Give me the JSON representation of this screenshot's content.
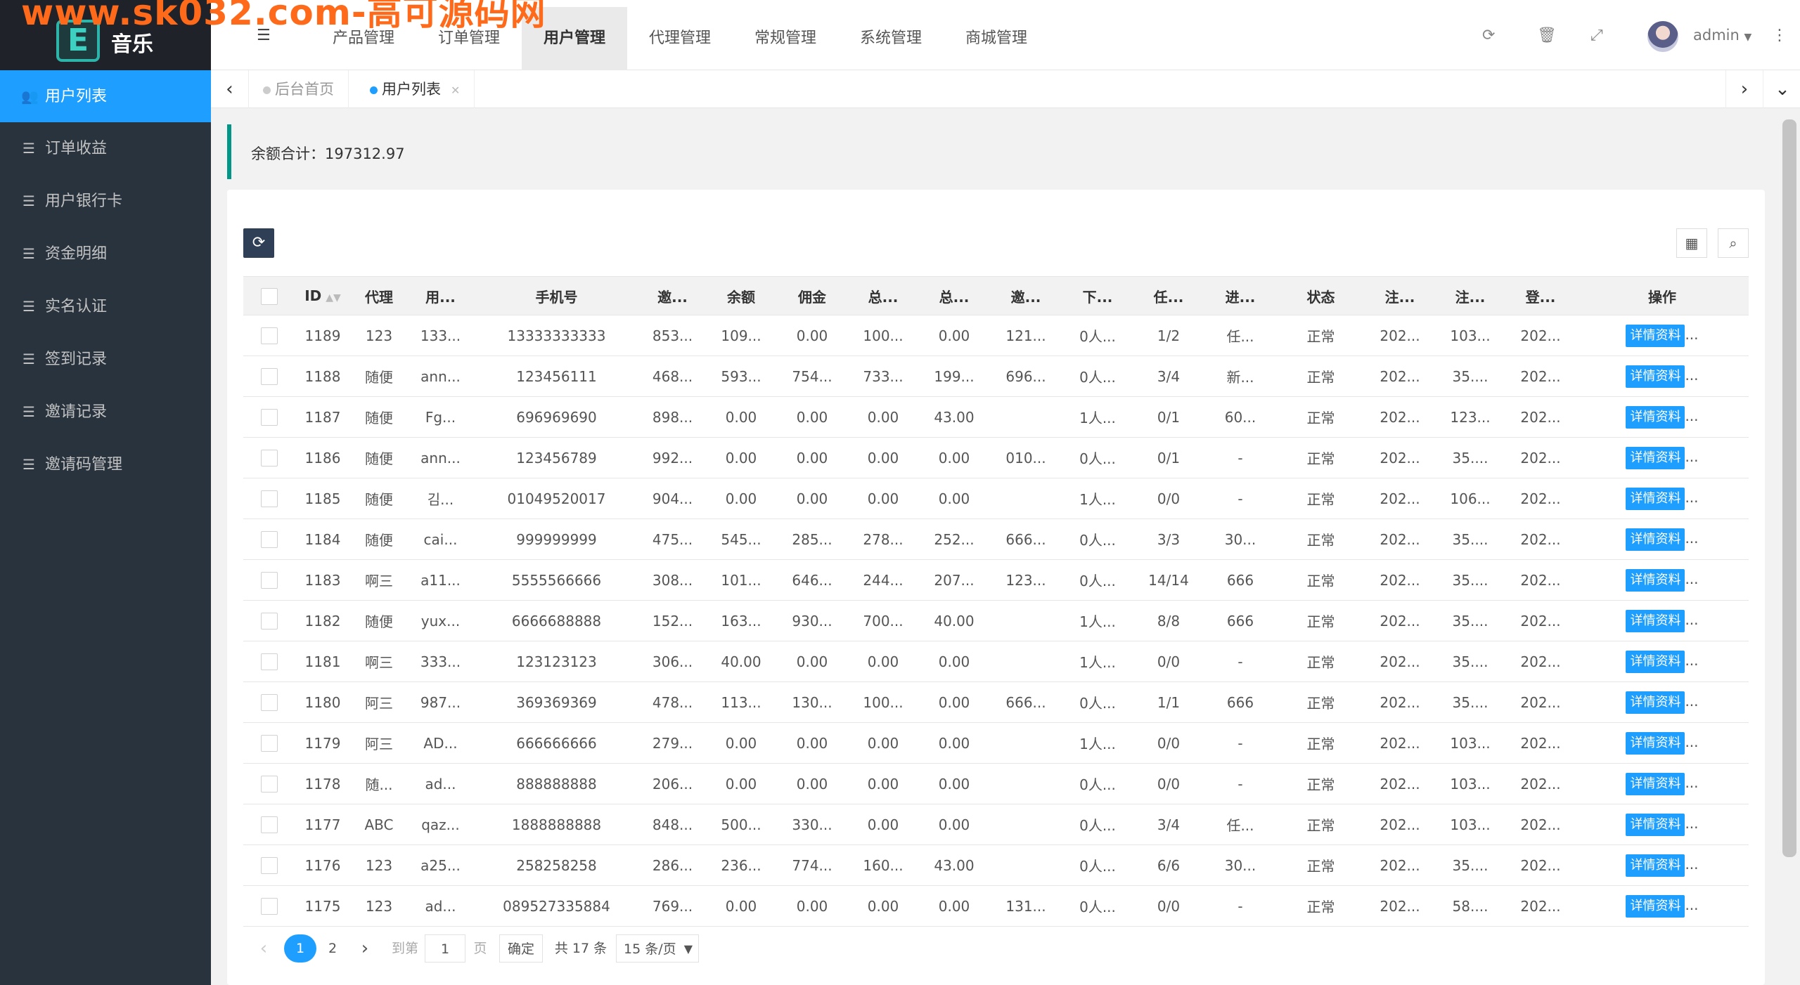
{
  "watermark": "www.sk032.com-高可源码网",
  "logo": {
    "letter": "E",
    "text": "音乐"
  },
  "sidebar": {
    "items": [
      {
        "label": "用户列表",
        "icon": "users-icon"
      },
      {
        "label": "订单收益",
        "icon": "list-icon"
      },
      {
        "label": "用户银行卡",
        "icon": "list-icon"
      },
      {
        "label": "资金明细",
        "icon": "list-icon"
      },
      {
        "label": "实名认证",
        "icon": "list-icon"
      },
      {
        "label": "签到记录",
        "icon": "list-icon"
      },
      {
        "label": "邀请记录",
        "icon": "list-icon"
      },
      {
        "label": "邀请码管理",
        "icon": "list-icon"
      }
    ]
  },
  "header": {
    "nav": [
      "产品管理",
      "订单管理",
      "用户管理",
      "代理管理",
      "常规管理",
      "系统管理",
      "商城管理"
    ],
    "active_nav": "用户管理",
    "user": "admin"
  },
  "tabs": [
    {
      "label": "后台首页"
    },
    {
      "label": "用户列表"
    }
  ],
  "notice": "余额合计：197312.97",
  "table": {
    "columns": [
      "",
      "ID",
      "代理",
      "用...",
      "手机号",
      "邀...",
      "余额",
      "佣金",
      "总...",
      "总...",
      "邀...",
      "下...",
      "任...",
      "进...",
      "状态",
      "注...",
      "注...",
      "登...",
      "操作"
    ],
    "rows": [
      [
        "1189",
        "123",
        "133...",
        "13333333333",
        "853...",
        "109...",
        "0.00",
        "100...",
        "0.00",
        "121...",
        "0人...",
        "1/2",
        "任...",
        "正常",
        "202...",
        "103...",
        "202..."
      ],
      [
        "1188",
        "随便",
        "ann...",
        "123456111",
        "468...",
        "593...",
        "754...",
        "733...",
        "199...",
        "696...",
        "0人...",
        "3/4",
        "新...",
        "正常",
        "202...",
        "35....",
        "202..."
      ],
      [
        "1187",
        "随便",
        "Fg...",
        "696969690",
        "898...",
        "0.00",
        "0.00",
        "0.00",
        "43.00",
        "",
        "1人...",
        "0/1",
        "60...",
        "正常",
        "202...",
        "123...",
        "202..."
      ],
      [
        "1186",
        "随便",
        "ann...",
        "123456789",
        "992...",
        "0.00",
        "0.00",
        "0.00",
        "0.00",
        "010...",
        "0人...",
        "0/1",
        "-",
        "正常",
        "202...",
        "35....",
        "202..."
      ],
      [
        "1185",
        "随便",
        "김...",
        "01049520017",
        "904...",
        "0.00",
        "0.00",
        "0.00",
        "0.00",
        "",
        "1人...",
        "0/0",
        "-",
        "正常",
        "202...",
        "106...",
        "202..."
      ],
      [
        "1184",
        "随便",
        "cai...",
        "999999999",
        "475...",
        "545...",
        "285...",
        "278...",
        "252...",
        "666...",
        "0人...",
        "3/3",
        "30...",
        "正常",
        "202...",
        "35....",
        "202..."
      ],
      [
        "1183",
        "啊三",
        "a11...",
        "5555566666",
        "308...",
        "101...",
        "646...",
        "244...",
        "207...",
        "123...",
        "0人...",
        "14/14",
        "666",
        "正常",
        "202...",
        "35....",
        "202..."
      ],
      [
        "1182",
        "随便",
        "yux...",
        "6666688888",
        "152...",
        "163...",
        "930...",
        "700...",
        "40.00",
        "",
        "1人...",
        "8/8",
        "666",
        "正常",
        "202...",
        "35....",
        "202..."
      ],
      [
        "1181",
        "啊三",
        "333...",
        "123123123",
        "306...",
        "40.00",
        "0.00",
        "0.00",
        "0.00",
        "",
        "1人...",
        "0/0",
        "-",
        "正常",
        "202...",
        "35....",
        "202..."
      ],
      [
        "1180",
        "阿三",
        "987...",
        "369369369",
        "478...",
        "113...",
        "130...",
        "100...",
        "0.00",
        "666...",
        "0人...",
        "1/1",
        "666",
        "正常",
        "202...",
        "35....",
        "202..."
      ],
      [
        "1179",
        "阿三",
        "AD...",
        "666666666",
        "279...",
        "0.00",
        "0.00",
        "0.00",
        "0.00",
        "",
        "1人...",
        "0/0",
        "-",
        "正常",
        "202...",
        "103...",
        "202..."
      ],
      [
        "1178",
        "随...",
        "ad...",
        "888888888",
        "206...",
        "0.00",
        "0.00",
        "0.00",
        "0.00",
        "",
        "0人...",
        "0/0",
        "-",
        "正常",
        "202...",
        "103...",
        "202..."
      ],
      [
        "1177",
        "ABC",
        "qaz...",
        "1888888888",
        "848...",
        "500...",
        "330...",
        "0.00",
        "0.00",
        "",
        "0人...",
        "3/4",
        "任...",
        "正常",
        "202...",
        "103...",
        "202..."
      ],
      [
        "1176",
        "123",
        "a25...",
        "258258258",
        "286...",
        "236...",
        "774...",
        "160...",
        "43.00",
        "",
        "0人...",
        "6/6",
        "30...",
        "正常",
        "202...",
        "35....",
        "202..."
      ],
      [
        "1175",
        "123",
        "ad...",
        "089527335884",
        "769...",
        "0.00",
        "0.00",
        "0.00",
        "0.00",
        "131...",
        "0人...",
        "0/0",
        "-",
        "正常",
        "202...",
        "58....",
        "202..."
      ]
    ],
    "action_label": "详情资料",
    "action_suffix": "..."
  },
  "pager": {
    "prev": "‹",
    "pages": [
      "1",
      "2"
    ],
    "next": "›",
    "goto_label": "到第",
    "goto_value": "1",
    "page_unit": "页",
    "confirm": "确定",
    "total": "共 17 条",
    "per_page": "15 条/页"
  },
  "colors": {
    "accent": "#1e9fff",
    "sidebar": "#28333e",
    "notice_border": "#009688"
  }
}
